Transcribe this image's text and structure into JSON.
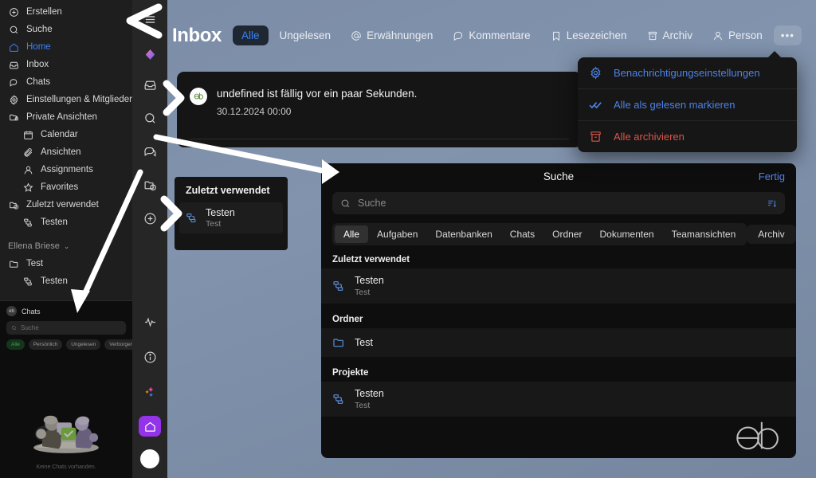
{
  "theme": {
    "background": "#7d8da8",
    "sidebar_bg": "#1e1e1e",
    "rail_bg": "#262626",
    "panel_bg": "#0e0e0e",
    "accent_blue": "#3b82f6",
    "accent_purple": "#9333ea",
    "accent_red": "#d9564a",
    "accent_green": "#3fa34d"
  },
  "sidebar": {
    "items": [
      {
        "label": "Erstellen",
        "icon": "plus-circle-icon",
        "active": false,
        "indent": false
      },
      {
        "label": "Suche",
        "icon": "search-icon",
        "active": false,
        "indent": false
      },
      {
        "label": "Home",
        "icon": "home-icon",
        "active": true,
        "indent": false
      },
      {
        "label": "Inbox",
        "icon": "inbox-icon",
        "active": false,
        "indent": false
      },
      {
        "label": "Chats",
        "icon": "chat-icon",
        "active": false,
        "indent": false
      },
      {
        "label": "Einstellungen & Mitglieder",
        "icon": "gear-icon",
        "active": false,
        "indent": false
      },
      {
        "label": "Private Ansichten",
        "icon": "folder-lock-icon",
        "active": false,
        "indent": false
      },
      {
        "label": "Calendar",
        "icon": "calendar-icon",
        "active": false,
        "indent": true
      },
      {
        "label": "Ansichten",
        "icon": "paperclip-icon",
        "active": false,
        "indent": true
      },
      {
        "label": "Assignments",
        "icon": "person-icon",
        "active": false,
        "indent": true
      },
      {
        "label": "Favorites",
        "icon": "star-icon",
        "active": false,
        "indent": true
      },
      {
        "label": "Zuletzt verwendet",
        "icon": "folder-clock-icon",
        "active": false,
        "indent": false
      },
      {
        "label": "Testen",
        "icon": "project-icon",
        "active": false,
        "indent": true
      }
    ],
    "user": {
      "name": "Ellena Briese",
      "chevron": "⌄"
    },
    "workspace_items": [
      {
        "label": "Test",
        "icon": "folder-icon",
        "indent": false
      },
      {
        "label": "Testen",
        "icon": "project-icon",
        "indent": true
      }
    ]
  },
  "chats_panel": {
    "title": "Chats",
    "avatar_initials": "eb",
    "search_placeholder": "Suche",
    "chips": [
      {
        "label": "Alle",
        "active": true
      },
      {
        "label": "Persönlich",
        "active": false
      },
      {
        "label": "Ungelesen",
        "active": false
      },
      {
        "label": "Verborgen",
        "active": false
      }
    ],
    "empty_text": "Keine Chats vorhanden."
  },
  "rail": {
    "icons": [
      "hamburger-icon",
      "diamond-gradient-icon",
      "inbox-icon",
      "search-icon",
      "chat-icon",
      "folder-clock-icon",
      "plus-circle-icon"
    ],
    "bottom_icons": [
      "activity-icon",
      "info-icon",
      "sparkle-icon"
    ],
    "home_button": "home-icon",
    "avatar": "white-circle-avatar"
  },
  "header": {
    "title": "Inbox",
    "tabs": [
      {
        "label": "Alle",
        "icon": null,
        "active": true
      },
      {
        "label": "Ungelesen",
        "icon": null,
        "active": false
      },
      {
        "label": "Erwähnungen",
        "icon": "at-icon",
        "active": false
      },
      {
        "label": "Kommentare",
        "icon": "comment-icon",
        "active": false
      },
      {
        "label": "Lesezeichen",
        "icon": "bookmark-icon",
        "active": false
      },
      {
        "label": "Archiv",
        "icon": "archive-icon",
        "active": false
      },
      {
        "label": "Person",
        "icon": "person-icon",
        "active": false
      },
      {
        "label": "•••",
        "icon": null,
        "active": false
      }
    ]
  },
  "dropdown": {
    "items": [
      {
        "label": "Benachrichtigungseinstellungen",
        "icon": "gear-icon",
        "tone": "blue"
      },
      {
        "label": "Alle als gelesen markieren",
        "icon": "double-check-icon",
        "tone": "blue"
      },
      {
        "label": "Alle archivieren",
        "icon": "archive-icon",
        "tone": "red"
      }
    ]
  },
  "notification": {
    "avatar_initials": "eb",
    "text": "undefined ist fällig vor ein paar Sekunden.",
    "timestamp": "30.12.2024 00:00"
  },
  "recent_popup": {
    "header": "Zuletzt verwendet",
    "item": {
      "title": "Testen",
      "subtitle": "Test",
      "icon": "project-icon"
    }
  },
  "search_dialog": {
    "title": "Suche",
    "done_label": "Fertig",
    "search_placeholder": "Suche",
    "sort_icon": "sort-icon",
    "filters": [
      {
        "label": "Alle",
        "active": true
      },
      {
        "label": "Aufgaben",
        "active": false
      },
      {
        "label": "Datenbanken",
        "active": false
      },
      {
        "label": "Chats",
        "active": false
      },
      {
        "label": "Ordner",
        "active": false
      },
      {
        "label": "Dokumenten",
        "active": false
      },
      {
        "label": "Teamansichten",
        "active": false
      }
    ],
    "archive_filter": {
      "label": "Archiv",
      "active": false
    },
    "sections": [
      {
        "title": "Zuletzt verwendet",
        "rows": [
          {
            "title": "Testen",
            "subtitle": "Test",
            "icon": "project-icon"
          }
        ]
      },
      {
        "title": "Ordner",
        "rows": [
          {
            "title": "Test",
            "subtitle": "",
            "icon": "folder-icon"
          }
        ]
      },
      {
        "title": "Projekte",
        "rows": [
          {
            "title": "Testen",
            "subtitle": "Test",
            "icon": "project-icon"
          }
        ]
      }
    ],
    "watermark": "eb"
  }
}
